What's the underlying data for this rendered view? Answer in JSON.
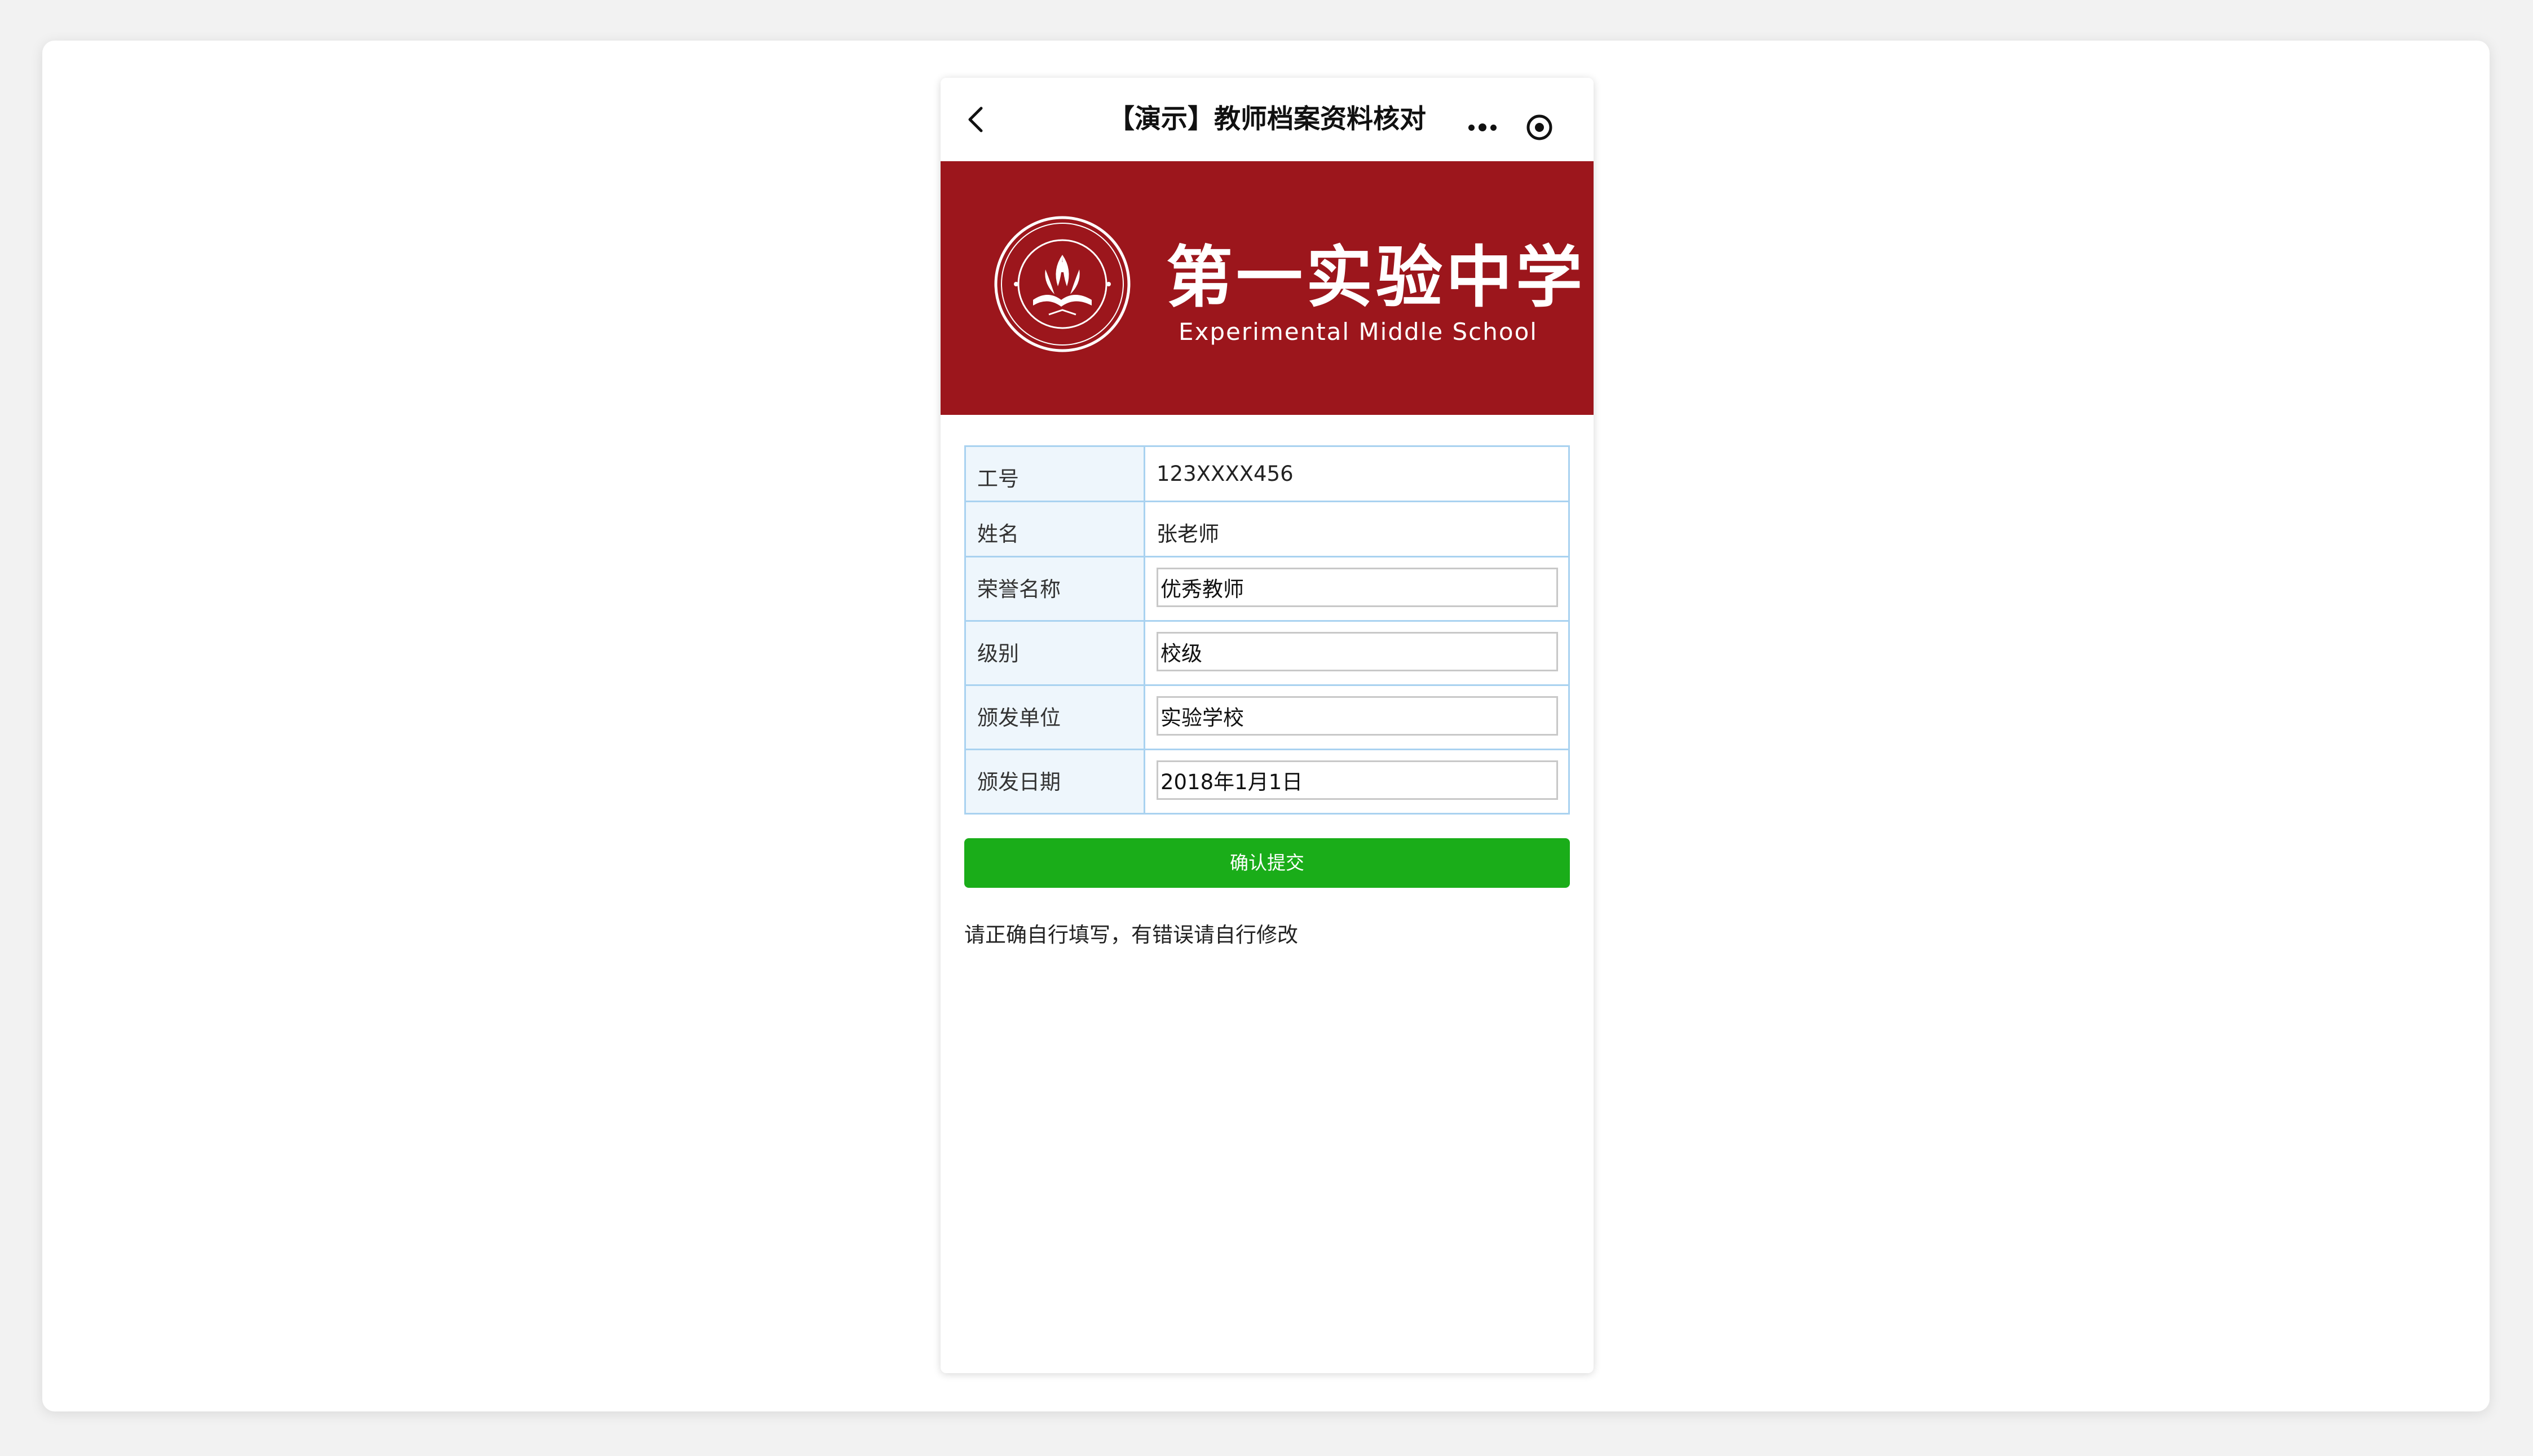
{
  "navbar": {
    "title": "【演示】教师档案资料核对",
    "back_icon": "chevron-left-icon",
    "more_icon": "more-dots-icon",
    "close_icon": "target-circle-icon"
  },
  "banner": {
    "school_name_cn": "第一实验中学",
    "school_name_en": "Experimental Middle School",
    "emblem_text": "第一实验中学 Experimental Middle School",
    "background_color": "#9c161c"
  },
  "form": {
    "rows": [
      {
        "label": "工号",
        "value": "123XXXX456",
        "editable": false
      },
      {
        "label": "姓名",
        "value": "张老师",
        "editable": false
      },
      {
        "label": "荣誉名称",
        "value": "优秀教师",
        "editable": true
      },
      {
        "label": "级别",
        "value": "校级",
        "editable": true
      },
      {
        "label": "颁发单位",
        "value": "实验学校",
        "editable": true
      },
      {
        "label": "颁发日期",
        "value": "2018年1月1日",
        "editable": true
      }
    ]
  },
  "submit": {
    "label": "确认提交",
    "color": "#1aad19"
  },
  "hint": "请正确自行填写，有错误请自行修改"
}
